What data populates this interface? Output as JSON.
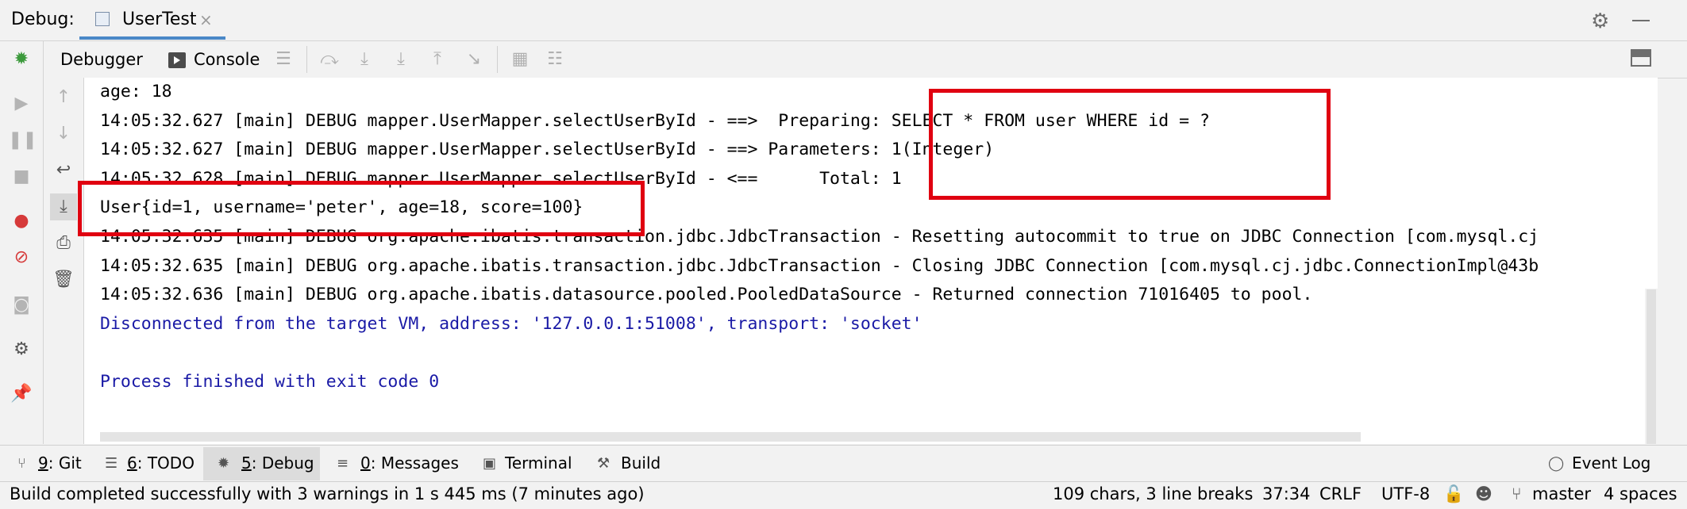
{
  "title_bar": {
    "label": "Debug:",
    "tab_label": "UserTest",
    "tab_close": "×"
  },
  "toolbar": {
    "debugger_tab": "Debugger",
    "console_tab": "Console"
  },
  "console": {
    "lines": [
      {
        "text": "age: 18",
        "style": "normal"
      },
      {
        "text": "14:05:32.627 [main] DEBUG mapper.UserMapper.selectUserById - ==>  Preparing: SELECT * FROM user WHERE id = ?",
        "style": "normal"
      },
      {
        "text": "14:05:32.627 [main] DEBUG mapper.UserMapper.selectUserById - ==> Parameters: 1(Integer)",
        "style": "normal"
      },
      {
        "text": "14:05:32.628 [main] DEBUG mapper.UserMapper.selectUserById - <==      Total: 1",
        "style": "normal"
      },
      {
        "text": "User{id=1, username='peter', age=18, score=100}",
        "style": "normal"
      },
      {
        "text": "14:05:32.635 [main] DEBUG org.apache.ibatis.transaction.jdbc.JdbcTransaction - Resetting autocommit to true on JDBC Connection [com.mysql.cj",
        "style": "normal"
      },
      {
        "text": "14:05:32.635 [main] DEBUG org.apache.ibatis.transaction.jdbc.JdbcTransaction - Closing JDBC Connection [com.mysql.cj.jdbc.ConnectionImpl@43b",
        "style": "normal"
      },
      {
        "text": "14:05:32.636 [main] DEBUG org.apache.ibatis.datasource.pooled.PooledDataSource - Returned connection 71016405 to pool.",
        "style": "normal"
      },
      {
        "text": "Disconnected from the target VM, address: '127.0.0.1:51008', transport: 'socket'",
        "style": "blue"
      },
      {
        "text": "",
        "style": "normal"
      },
      {
        "text": "Process finished with exit code 0",
        "style": "blue"
      }
    ]
  },
  "bottom_tools": {
    "git": {
      "key": "9",
      "label": ": Git"
    },
    "todo": {
      "key": "6",
      "label": ": TODO"
    },
    "debug": {
      "key": "5",
      "label": ": Debug"
    },
    "messages": {
      "key": "0",
      "label": ": Messages"
    },
    "terminal": "Terminal",
    "build": "Build",
    "event_log": "Event Log"
  },
  "status_bar": {
    "message": "Build completed successfully with 3 warnings in 1 s 445 ms (7 minutes ago)",
    "selection": "109 chars, 3 line breaks",
    "position": "37:34",
    "line_separator": "CRLF",
    "encoding": "UTF-8",
    "branch": "master",
    "indent": "4 spaces"
  },
  "colors": {
    "highlight_box": "#e00010",
    "console_info_text": "#1a1aa6",
    "active_tab_underline": "#4a88c7"
  }
}
